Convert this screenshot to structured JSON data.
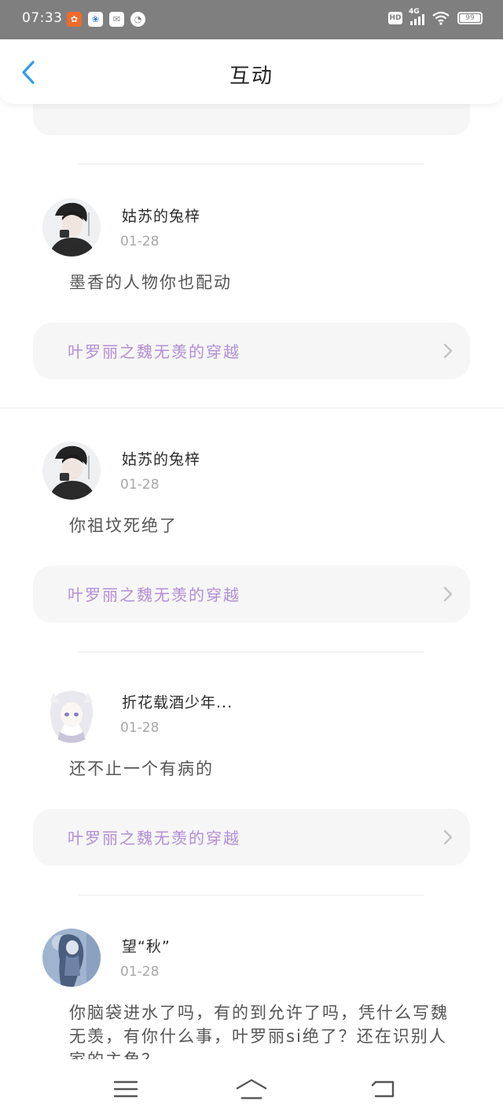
{
  "status_bar": {
    "time": "07:33",
    "hd": "HD",
    "network": "4G",
    "battery": "99"
  },
  "header": {
    "title": "互动"
  },
  "comments": [
    {
      "username": "姑苏的兔梓",
      "date": "01-28",
      "text": "墨香的人物你也配动",
      "book": "叶罗丽之魏无羡的穿越"
    },
    {
      "username": "姑苏的兔梓",
      "date": "01-28",
      "text": "你祖坟死绝了",
      "book": "叶罗丽之魏无羡的穿越"
    },
    {
      "username": "折花载酒少年...",
      "date": "01-28",
      "text": "还不止一个有病的",
      "book": "叶罗丽之魏无羡的穿越"
    },
    {
      "username": "望“秋”",
      "date": "01-28",
      "text": "你脑袋进水了吗，有的到允许了吗，凭什么写魏无羡，有你什么事，叶罗丽si绝了？还在识别人家的主角？"
    }
  ],
  "colors": {
    "accent": "#2e9cf0",
    "book_link_text": "#b38ed6",
    "status_bar": "#7f7f7f"
  },
  "icons": {
    "back": "chevron-left-icon",
    "link": "chevron-right-icon",
    "nav_menu": "menu-icon",
    "nav_home": "home-icon",
    "nav_back": "back-icon"
  }
}
